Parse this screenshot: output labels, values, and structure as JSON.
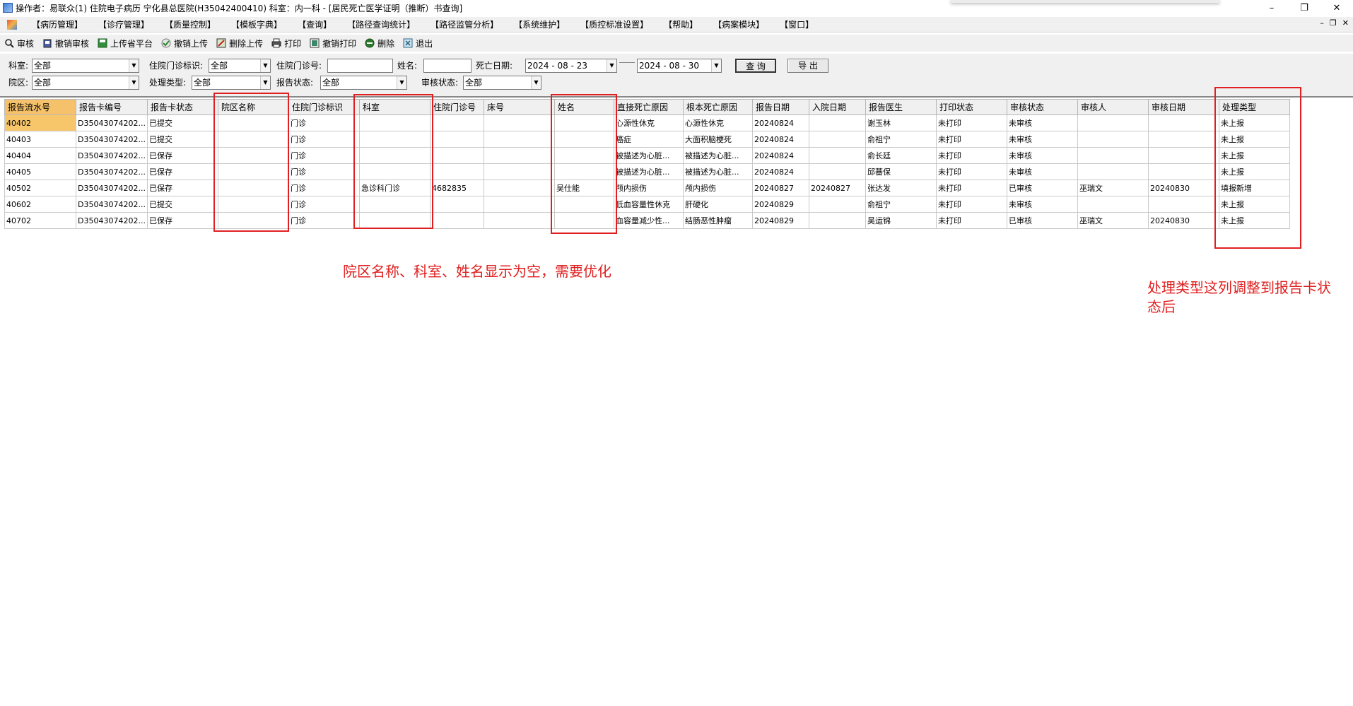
{
  "window": {
    "title": "操作者：易联众(1) 住院电子病历  宁化县总医院(H35042400410)  科室：内一科 - [居民死亡医学证明（推断）书查询]",
    "controls": [
      "–",
      "❐",
      "✕"
    ]
  },
  "menu": {
    "items": [
      "【病历管理】",
      "【诊疗管理】",
      "【质量控制】",
      "【模板字典】",
      "【查询】",
      "【路径查询统计】",
      "【路径监管分析】",
      "【系统维护】",
      "【质控标准设置】",
      "【帮助】",
      "【病案模块】",
      "【窗口】"
    ],
    "mdi_controls": [
      "–",
      "❐",
      "✕"
    ]
  },
  "toolbar": {
    "buttons": [
      {
        "label": "审核",
        "icon": "magnifier-icon"
      },
      {
        "label": "撤销审核",
        "icon": "undo-review-icon"
      },
      {
        "label": "上传省平台",
        "icon": "save-upload-icon"
      },
      {
        "label": "撤销上传",
        "icon": "check-icon"
      },
      {
        "label": "删除上传",
        "icon": "delete-upload-icon"
      },
      {
        "label": "打印",
        "icon": "printer-icon"
      },
      {
        "label": "撤销打印",
        "icon": "undo-print-icon"
      },
      {
        "label": "删除",
        "icon": "delete-icon"
      },
      {
        "label": "退出",
        "icon": "exit-icon"
      }
    ]
  },
  "filters": {
    "dept_label": "科室:",
    "dept_value": "全部",
    "visit_flag_label": "住院门诊标识:",
    "visit_flag_value": "全部",
    "visit_no_label": "住院门诊号:",
    "visit_no_value": "",
    "name_label": "姓名:",
    "name_value": "",
    "death_date_label": "死亡日期:",
    "date_from": "2024 - 08 - 23",
    "date_to": "2024 - 08 - 30",
    "query_button": "查 询",
    "export_button": "导 出",
    "campus_label": "院区:",
    "campus_value": "全部",
    "handle_type_label": "处理类型:",
    "handle_type_value": "全部",
    "report_status_label": "报告状态:",
    "report_status_value": "全部",
    "review_status_label": "审核状态:",
    "review_status_value": "全部"
  },
  "grid": {
    "columns": [
      "报告流水号",
      "报告卡编号",
      "报告卡状态",
      "院区名称",
      "住院门诊标识",
      "科室",
      "住院门诊号",
      "床号",
      "姓名",
      "直接死亡原因",
      "根本死亡原因",
      "报告日期",
      "入院日期",
      "报告医生",
      "打印状态",
      "审核状态",
      "审核人",
      "审核日期",
      "处理类型"
    ],
    "rows": [
      [
        "40402",
        "D35043074202...",
        "已提交",
        "",
        "门诊",
        "",
        "",
        "",
        "",
        "心源性休克",
        "心源性休克",
        "20240824",
        "",
        "谢玉林",
        "未打印",
        "未审核",
        "",
        "",
        "未上报"
      ],
      [
        "40403",
        "D35043074202...",
        "已提交",
        "",
        "门诊",
        "",
        "",
        "",
        "",
        "癌症",
        "大面积脑梗死",
        "20240824",
        "",
        "俞祖宁",
        "未打印",
        "未审核",
        "",
        "",
        "未上报"
      ],
      [
        "40404",
        "D35043074202...",
        "已保存",
        "",
        "门诊",
        "",
        "",
        "",
        "",
        "被描述为心脏...",
        "被描述为心脏...",
        "20240824",
        "",
        "俞长廷",
        "未打印",
        "未审核",
        "",
        "",
        "未上报"
      ],
      [
        "40405",
        "D35043074202...",
        "已保存",
        "",
        "门诊",
        "",
        "",
        "",
        "",
        "被描述为心脏...",
        "被描述为心脏...",
        "20240824",
        "",
        "邱蕃保",
        "未打印",
        "未审核",
        "",
        "",
        "未上报"
      ],
      [
        "40502",
        "D35043074202...",
        "已保存",
        "",
        "门诊",
        "急诊科门诊",
        "4682835",
        "",
        "吴仕能",
        "颅内损伤",
        "颅内损伤",
        "20240827",
        "20240827",
        "张达发",
        "未打印",
        "已审核",
        "巫瑞文",
        "20240830",
        "填报新增"
      ],
      [
        "40602",
        "D35043074202...",
        "已提交",
        "",
        "门诊",
        "",
        "",
        "",
        "",
        "低血容量性休克",
        "肝硬化",
        "20240829",
        "",
        "俞祖宁",
        "未打印",
        "未审核",
        "",
        "",
        "未上报"
      ],
      [
        "40702",
        "D35043074202...",
        "已保存",
        "",
        "门诊",
        "",
        "",
        "",
        "",
        "血容量减少性...",
        "结肠恶性肿瘤",
        "20240829",
        "",
        "吴运锦",
        "未打印",
        "已审核",
        "巫瑞文",
        "20240830",
        "未上报"
      ]
    ]
  },
  "annotations": {
    "note_empty_columns": "院区名称、科室、姓名显示为空，需要优化",
    "note_move_column_line1": "处理类型这列调整到报告卡状",
    "note_move_column_line2": "态后",
    "color": "#e02020"
  }
}
